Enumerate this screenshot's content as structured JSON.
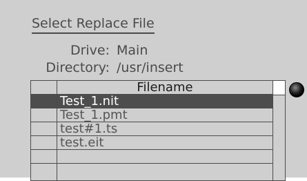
{
  "dialog": {
    "title": "Select Replace File",
    "drive_label": "Drive:",
    "drive_value": "Main",
    "directory_label": "Directory:",
    "directory_value": "/usr/insert"
  },
  "file_table": {
    "column_header": "Filename",
    "rows": [
      {
        "name": "Test_1.nit",
        "selected": true
      },
      {
        "name": "Test_1.pmt",
        "selected": false
      },
      {
        "name": "test#1.ts",
        "selected": false
      },
      {
        "name": "test.eit",
        "selected": false
      },
      {
        "name": "",
        "selected": false
      },
      {
        "name": "",
        "selected": false
      }
    ]
  },
  "colors": {
    "background": "#cfcfcf",
    "text": "#4a4a4a",
    "selection": "#4d4d4d"
  }
}
